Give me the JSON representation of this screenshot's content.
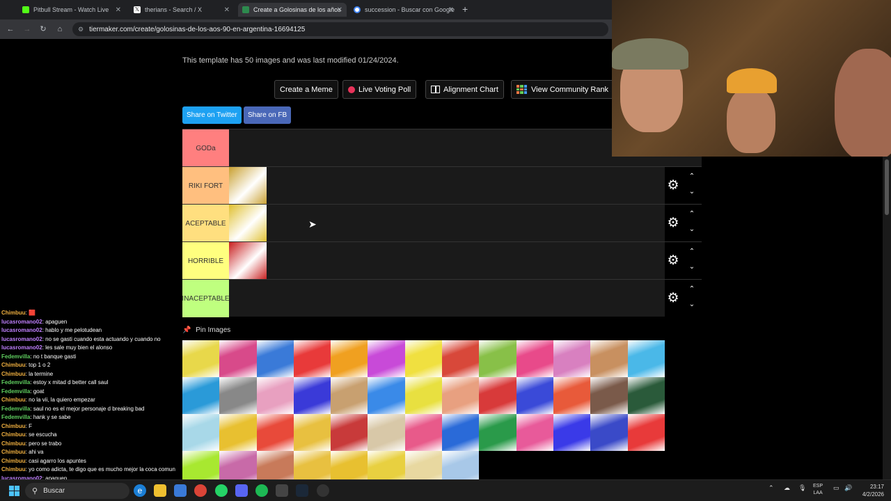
{
  "browser": {
    "tabs": [
      {
        "label": "Pitbull Stream - Watch Live",
        "color": "#53fc18",
        "icon": "kick-icon"
      },
      {
        "label": "therians - Search / X",
        "color": "#ffffff",
        "icon": "x-icon"
      },
      {
        "label": "Create a Golosinas de los años",
        "color": "#2d8a4e",
        "icon": "tiermaker-icon"
      },
      {
        "label": "succession - Buscar con Google",
        "color": "#4285f4",
        "icon": "google-icon"
      }
    ],
    "url": "tiermaker.com/create/golosinas-de-los-aos-90-en-argentina-16694125"
  },
  "page": {
    "template_info": "This template has 50 images and was last modified 01/24/2024.",
    "buttons": {
      "create_meme": "Create a Meme",
      "live_voting": "Live Voting Poll",
      "alignment_chart": "Alignment Chart",
      "community_rank": "View Community Rank"
    },
    "share": {
      "twitter": "Share on Twitter",
      "facebook": "Share on FB"
    },
    "pin_images": "Pin Images",
    "tiers": [
      {
        "label": "GODa",
        "color": "#ff7f7f",
        "items": []
      },
      {
        "label": "RIKI FORT",
        "color": "#ffbf7f",
        "items": [
          "#c9a030"
        ]
      },
      {
        "label": "ACEPTABLE",
        "color": "#ffdf7f",
        "items": [
          "#e0c030"
        ]
      },
      {
        "label": "HORRIBLE",
        "color": "#ffff7f",
        "items": [
          "#c81e1e"
        ]
      },
      {
        "label": "INACEPTABLE",
        "color": "#bfff7f",
        "items": []
      }
    ],
    "pool_colors": [
      "#e8d84a",
      "#d84a8a",
      "#3a7ad8",
      "#e83a3a",
      "#f0a020",
      "#c84ad8",
      "#f0e040",
      "#d8483a",
      "#88c048",
      "#e84a8a",
      "#d880c0",
      "#c89060",
      "#4ab8e8",
      "#2a9ad8",
      "#888888",
      "#e8a0c0",
      "#3a3ad8",
      "#c8a070",
      "#3a8ae8",
      "#e8e040",
      "#e8a080",
      "#d83a3a",
      "#3a4ad8",
      "#e85a3a",
      "#7a5a4a",
      "#2a5a3a",
      "#a8d8e8",
      "#e8c030",
      "#e84a3a",
      "#e8c040",
      "#c83a3a",
      "#d8c8a8",
      "#e85a8a",
      "#2a6ad8",
      "#2a9a4a",
      "#e85a9a",
      "#3a3ae8",
      "#3a4ac8",
      "#e83a3a",
      "#a8e830",
      "#c86aa8",
      "#c87a5a",
      "#e8c040",
      "#e8c030",
      "#e8d040",
      "#e8d8a0",
      "#a8c8e8"
    ]
  },
  "chat": [
    {
      "user": "Chimbuu",
      "color": "#f0b040",
      "msg": "🟥"
    },
    {
      "user": "lucasromano02",
      "color": "#c080ff",
      "msg": "apaguen"
    },
    {
      "user": "lucasromano02",
      "color": "#c080ff",
      "msg": "hablo y me pelotudean"
    },
    {
      "user": "lucasromano02",
      "color": "#c080ff",
      "msg": "no se gasti cuando esta actuando y cuando no"
    },
    {
      "user": "lucasromano02",
      "color": "#c080ff",
      "msg": "les sale muy bien el alonso"
    },
    {
      "user": "Fedemvilla",
      "color": "#60d060",
      "msg": "no t banque gasti"
    },
    {
      "user": "Chimbuu",
      "color": "#f0b040",
      "msg": "top 1 o 2"
    },
    {
      "user": "Chimbuu",
      "color": "#f0b040",
      "msg": "la termine"
    },
    {
      "user": "Fedemvilla",
      "color": "#60d060",
      "msg": "estoy x mitad d better call saul"
    },
    {
      "user": "Fedemvilla",
      "color": "#60d060",
      "msg": "goat"
    },
    {
      "user": "Chimbuu",
      "color": "#f0b040",
      "msg": "no la vii, la quiero empezar"
    },
    {
      "user": "Fedemvilla",
      "color": "#60d060",
      "msg": "saul no es el mejor personaje d breaking bad"
    },
    {
      "user": "Fedemvilla",
      "color": "#60d060",
      "msg": "hank y se sabe"
    },
    {
      "user": "Chimbuu",
      "color": "#f0b040",
      "msg": "F"
    },
    {
      "user": "Chimbuu",
      "color": "#f0b040",
      "msg": "se escucha"
    },
    {
      "user": "Chimbuu",
      "color": "#f0b040",
      "msg": "pero se trabo"
    },
    {
      "user": "Chimbuu",
      "color": "#f0b040",
      "msg": "ahi va"
    },
    {
      "user": "Chimbuu",
      "color": "#f0b040",
      "msg": "casi agarro los apuntes"
    },
    {
      "user": "Chimbuu",
      "color": "#f0b040",
      "msg": "yo como adicta, te digo que es mucho mejor la coca comun"
    },
    {
      "user": "lucasromano02",
      "color": "#c080ff",
      "msg": "apaguen"
    }
  ],
  "taskbar": {
    "search_label": "Buscar",
    "lang_line1": "ESP",
    "lang_line2": "LAA",
    "time": "23:17",
    "date": "4/2/2026"
  }
}
